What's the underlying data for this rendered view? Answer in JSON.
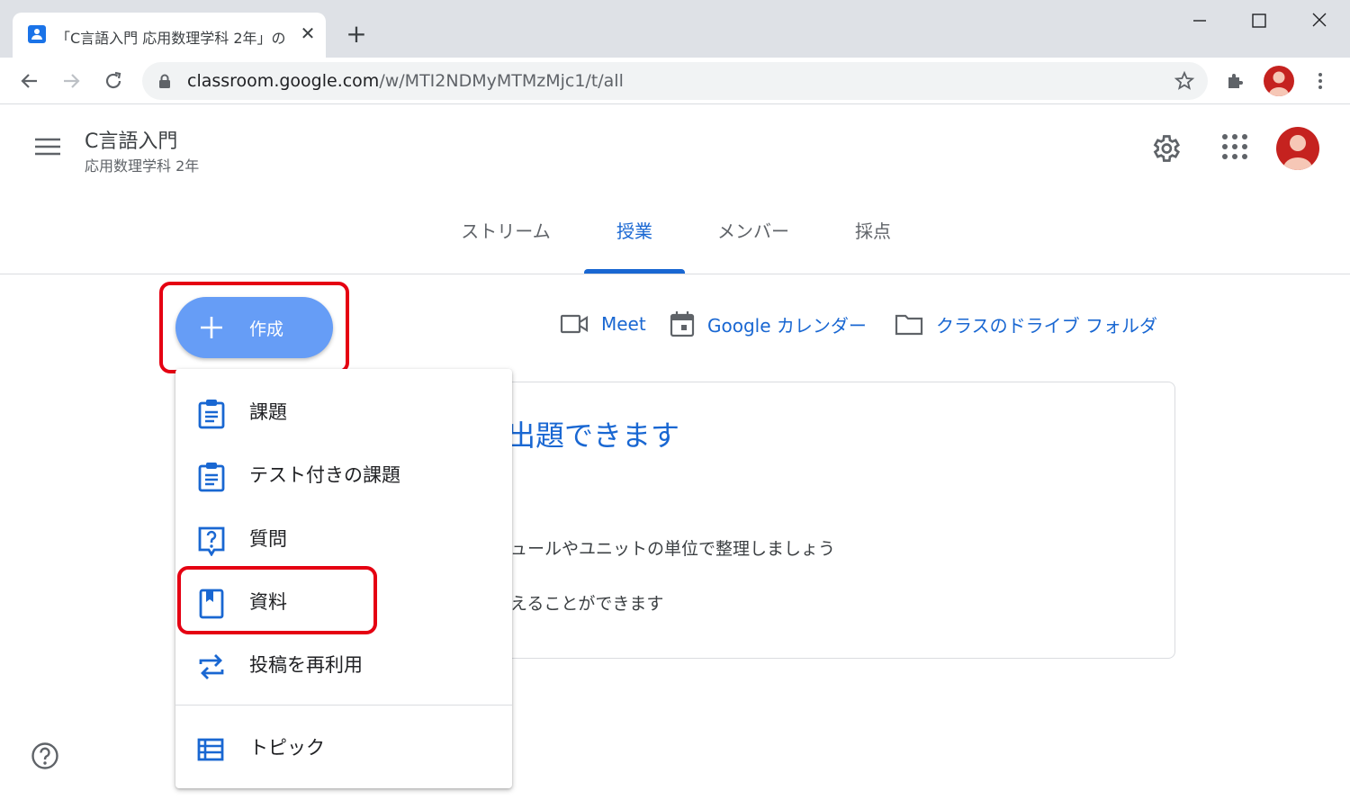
{
  "browser": {
    "tab_title": "「C言語入門 応用数理学科 2年」の",
    "tab_close": "✕",
    "new_tab": "+",
    "url_host": "classroom.google.com",
    "url_path": "/w/MTI2NDMyMTMzMjc1/t/all"
  },
  "header": {
    "class_title": "C言語入門",
    "class_subtitle": "応用数理学科 2年"
  },
  "nav_tabs": [
    {
      "label": "ストリーム",
      "active": false
    },
    {
      "label": "授業",
      "active": true
    },
    {
      "label": "メンバー",
      "active": false
    },
    {
      "label": "採点",
      "active": false
    }
  ],
  "create_button": {
    "label": "作成"
  },
  "quick_links": {
    "meet": "Meet",
    "calendar": "Google カレンダー",
    "drive_folder": "クラスのドライブ フォルダ"
  },
  "info_card": {
    "title": "出題できます",
    "line1": "ュールやユニットの単位で整理しましょう",
    "line2": "えることができます"
  },
  "dropdown": {
    "items": [
      {
        "label": "課題",
        "icon": "assignment-icon"
      },
      {
        "label": "テスト付きの課題",
        "icon": "quiz-assignment-icon"
      },
      {
        "label": "質問",
        "icon": "question-icon"
      },
      {
        "label": "資料",
        "icon": "material-icon"
      },
      {
        "label": "投稿を再利用",
        "icon": "reuse-post-icon"
      },
      {
        "label": "トピック",
        "icon": "topic-icon"
      }
    ]
  },
  "colors": {
    "accent_blue": "#1967d2",
    "create_button": "#669df6",
    "highlight_red": "#e50012",
    "avatar_red": "#c5221f"
  }
}
